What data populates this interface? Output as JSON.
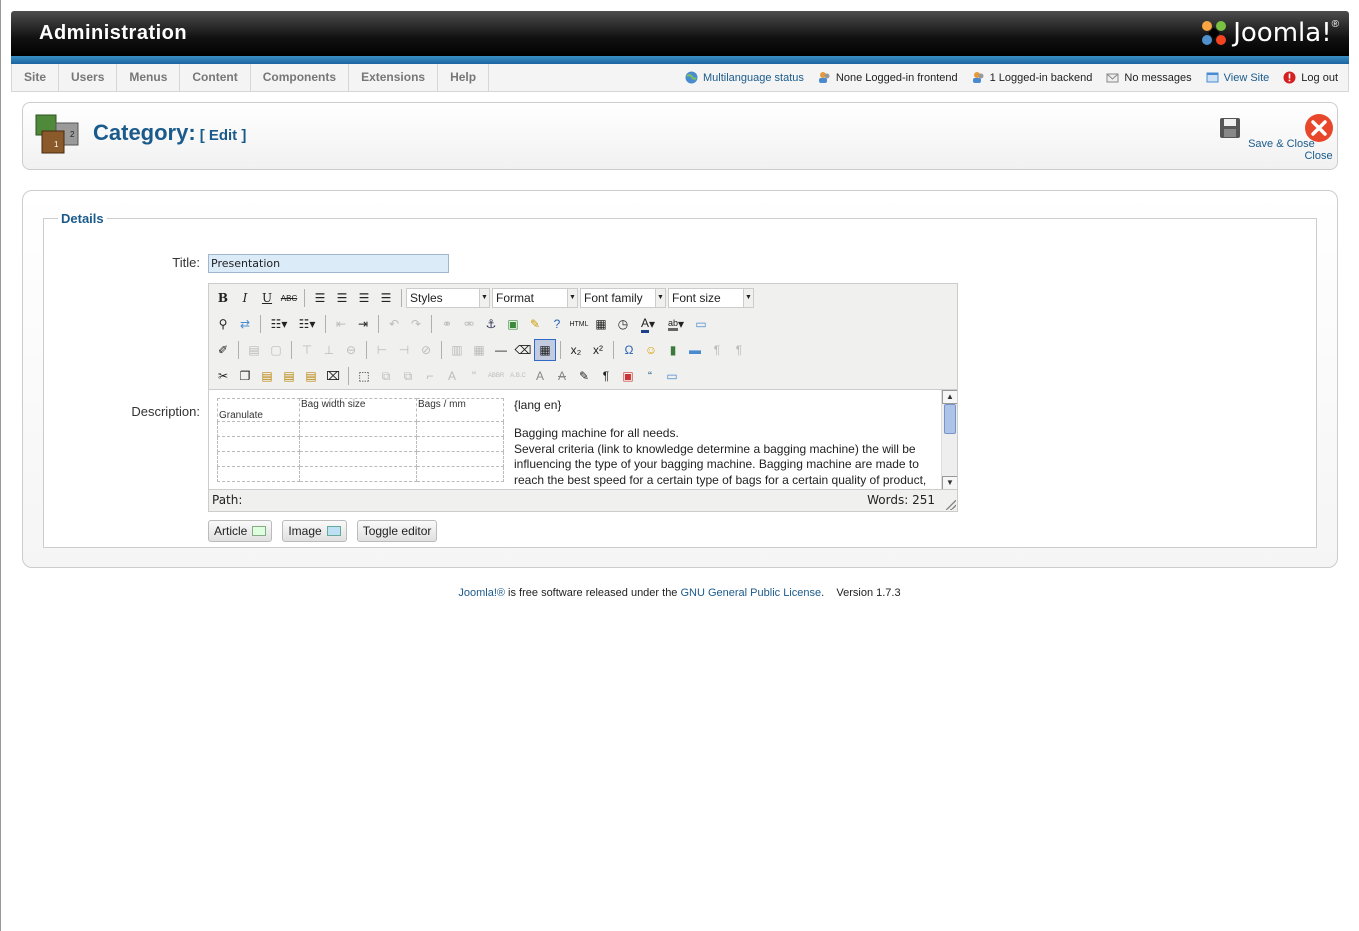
{
  "header": {
    "title": "Administration",
    "logo_text": "Joomla!",
    "logo_mark": "®"
  },
  "menu": {
    "items": [
      {
        "label": "Site"
      },
      {
        "label": "Users"
      },
      {
        "label": "Menus"
      },
      {
        "label": "Content"
      },
      {
        "label": "Components"
      },
      {
        "label": "Extensions"
      },
      {
        "label": "Help"
      }
    ]
  },
  "status": {
    "multilanguage": "Multilanguage status",
    "frontend": "None Logged-in frontend",
    "backend": "1 Logged-in backend",
    "messages": "No messages",
    "view_site": "View Site",
    "logout": "Log out"
  },
  "toolbar": {
    "title": "Category:",
    "subtitle": "[ Edit ]",
    "save_close_label": "Save & Close",
    "close_label": "Close"
  },
  "form": {
    "legend": "Details",
    "title_label": "Title:",
    "title_value": "Presentation",
    "description_label": "Description:"
  },
  "editor": {
    "dropdowns": {
      "styles": "Styles",
      "format": "Format",
      "font_family": "Font family",
      "font_size": "Font size"
    },
    "table": {
      "header": [
        "",
        "Bag width size",
        "Bags / mm"
      ],
      "first_cell": "Granulate"
    },
    "content": {
      "lang_tag": "{lang en}",
      "line1": "Bagging machine for all needs.",
      "line2": "Several criteria (link to knowledge determine a bagging machine) the will be influencing the type of your bagging machine. Bagging machine are made to reach the best speed for a certain type of bags for a certain quality of product,"
    },
    "path_label": "Path:",
    "words_label": "Words: 251",
    "buttons": {
      "article": "Article",
      "image": "Image",
      "toggle": "Toggle editor"
    }
  },
  "footer": {
    "joomla_link": "Joomla!®",
    "text1": " is free software released under the ",
    "license_link": "GNU General Public License",
    "text2": ".    Version 1.7.3"
  },
  "colors": {
    "accent": "#1b5b8c",
    "header_bg": "#111111",
    "strip": "#1b64a1"
  }
}
